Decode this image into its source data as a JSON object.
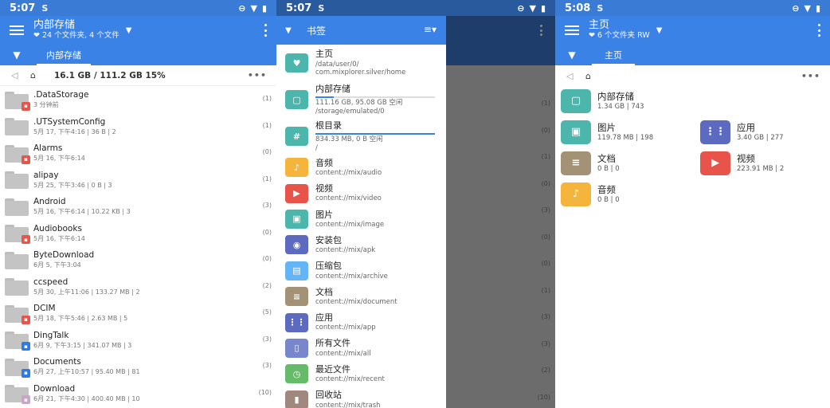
{
  "colors": {
    "accent": "#3b82e6",
    "statusbar": "#3a7bd5",
    "drawer_shade": "#6c6c6c"
  },
  "panel1": {
    "status": {
      "time": "5:07",
      "sim_icon": "S"
    },
    "appbar": {
      "title": "内部存储",
      "subtitle": "❤ 24 个文件夹, 4 个文件"
    },
    "tab": "内部存储",
    "path": {
      "info": "16.1 GB / 111.2 GB   15%"
    },
    "files": [
      {
        "name": ".DataStorage",
        "meta": "3 分钟前",
        "count": "(1)",
        "badge": "pdf",
        "badge_color": "#e8534a"
      },
      {
        "name": ".UTSystemConfig",
        "meta": "5月 17, 下午4:16 | 36 B | 2",
        "count": "(1)"
      },
      {
        "name": "Alarms",
        "meta": "5月 16, 下午6:14",
        "count": "(0)",
        "badge": "music",
        "badge_color": "#e8534a"
      },
      {
        "name": "alipay",
        "meta": "5月 25, 下午3:46 | 0 B | 3",
        "count": "(1)"
      },
      {
        "name": "Android",
        "meta": "5月 16, 下午6:14 | 10.22 KB | 3",
        "count": "(3)"
      },
      {
        "name": "Audiobooks",
        "meta": "5月 16, 下午6:14",
        "count": "(0)",
        "badge": "pdf",
        "badge_color": "#e8534a"
      },
      {
        "name": "ByteDownload",
        "meta": "6月 5, 下午3:04",
        "count": "(0)"
      },
      {
        "name": "ccspeed",
        "meta": "5月 30, 上午11:06 | 133.27 MB | 2",
        "count": "(2)"
      },
      {
        "name": "DCIM",
        "meta": "5月 18, 下午5:46 | 2.63 MB | 5",
        "count": "(5)",
        "badge": "image",
        "badge_color": "#e8534a"
      },
      {
        "name": "DingTalk",
        "meta": "6月 9, 下午3:15 | 341.07 MB | 3",
        "count": "(3)",
        "badge": "tag",
        "badge_color": "#2d7be5"
      },
      {
        "name": "Documents",
        "meta": "6月 27, 上午10:57 | 95.40 MB | 81",
        "count": "(3)",
        "badge": "doc",
        "badge_color": "#2d7be5"
      },
      {
        "name": "Download",
        "meta": "6月 21, 下午4:30 | 400.40 MB | 10",
        "count": "(10)",
        "badge": "anime",
        "badge_color": "#c9a6c8"
      }
    ]
  },
  "panel2": {
    "status": {
      "time": "5:07",
      "sim_icon": "S"
    },
    "drawer_title": "书签",
    "bookmarks": [
      {
        "name": "主页",
        "desc": "/data/user/0/",
        "desc2": "com.mixplorer.silver/home",
        "icon": "heart-icon",
        "glyph": "♥",
        "color": "#4db6ac"
      },
      {
        "name": "内部存储",
        "desc": "111.16 GB, 95.08 GB 空闲",
        "desc2": "/storage/emulated/0",
        "icon": "tablet-icon",
        "glyph": "▢",
        "color": "#4db6ac",
        "usage": 0.15
      },
      {
        "name": "根目录",
        "desc": "834.33 MB, 0 B 空闲",
        "desc2": "/",
        "icon": "hash-icon",
        "glyph": "#",
        "color": "#4db6ac",
        "usage": 1.0
      },
      {
        "name": "音频",
        "desc": "content://mix/audio",
        "icon": "music-icon",
        "glyph": "♪",
        "color": "#f5b43c"
      },
      {
        "name": "视频",
        "desc": "content://mix/video",
        "icon": "play-icon",
        "glyph": "▶",
        "color": "#e8534a"
      },
      {
        "name": "图片",
        "desc": "content://mix/image",
        "icon": "image-icon",
        "glyph": "▣",
        "color": "#4db6ac"
      },
      {
        "name": "安装包",
        "desc": "content://mix/apk",
        "icon": "android-icon",
        "glyph": "◉",
        "color": "#5c6bc0"
      },
      {
        "name": "压缩包",
        "desc": "content://mix/archive",
        "icon": "archive-icon",
        "glyph": "▤",
        "color": "#64b5f6"
      },
      {
        "name": "文档",
        "desc": "content://mix/document",
        "icon": "document-icon",
        "glyph": "≡",
        "color": "#a39276"
      },
      {
        "name": "应用",
        "desc": "content://mix/app",
        "icon": "apps-icon",
        "glyph": "⋮⋮",
        "color": "#5c6bc0"
      },
      {
        "name": "所有文件",
        "desc": "content://mix/all",
        "icon": "file-icon",
        "glyph": "▯",
        "color": "#7986cb"
      },
      {
        "name": "最近文件",
        "desc": "content://mix/recent",
        "icon": "clock-icon",
        "glyph": "◷",
        "color": "#66bb6a"
      },
      {
        "name": "回收站",
        "desc": "content://mix/trash",
        "icon": "trash-icon",
        "glyph": "▮",
        "color": "#a1887f"
      }
    ],
    "ghost_counts": [
      "(1)",
      "(0)",
      "(1)",
      "(0)",
      "(3)",
      "(0)",
      "(0)",
      "(1)",
      "(3)",
      "(3)",
      "(2)",
      "(10)"
    ]
  },
  "panel3": {
    "status": {
      "time": "5:08",
      "sim_icon": "S"
    },
    "appbar": {
      "title": "主页",
      "subtitle": "❤ 6 个文件夹 RW"
    },
    "tab": "主页",
    "tiles": [
      {
        "name": "内部存储",
        "desc": "1.34 GB | 743",
        "icon": "tablet-icon",
        "glyph": "▢",
        "color": "#4db6ac"
      },
      {
        "name": "图片",
        "desc": "119.78 MB | 198",
        "icon": "image-icon",
        "glyph": "▣",
        "color": "#4db6ac"
      },
      {
        "name": "应用",
        "desc": "3.40 GB | 277",
        "icon": "apps-icon",
        "glyph": "⋮⋮",
        "color": "#5c6bc0"
      },
      {
        "name": "文档",
        "desc": "0 B | 0",
        "icon": "document-icon",
        "glyph": "≡",
        "color": "#a39276"
      },
      {
        "name": "视频",
        "desc": "223.91 MB | 2",
        "icon": "play-icon",
        "glyph": "▶",
        "color": "#e8534a"
      },
      {
        "name": "音频",
        "desc": "0 B | 0",
        "icon": "music-icon",
        "glyph": "♪",
        "color": "#f5b43c"
      }
    ]
  }
}
